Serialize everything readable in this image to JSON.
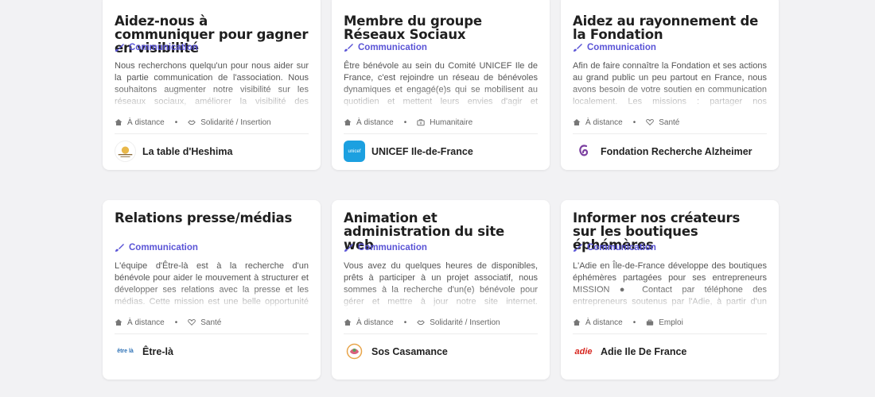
{
  "cards": [
    {
      "title": "Aidez-nous à communiquer pour gagner en visibilité",
      "tag": "Communication",
      "desc": "Nous recherchons quelqu'un pour nous aider sur la partie communication de l'association. Nous souhaitons augmenter notre visibilité sur les réseaux sociaux, améliorer la visibilité des évènements auxquels nous participons,",
      "location": "À distance",
      "cause": "Solidarité / Insertion",
      "cause_icon": "handshake-icon",
      "org": "La table d'Heshima"
    },
    {
      "title": "Membre du groupe Réseaux Sociaux",
      "tag": "Communication",
      "desc": "Être bénévole au sein du Comité UNICEF Ile de France, c'est rejoindre un réseau de bénévoles dynamiques et engagé(e)s qui se mobilisent au quotidien et mettent leurs envies d'agir et compétences au service des droits de l'enfant.",
      "location": "À distance",
      "cause": "Humanitaire",
      "cause_icon": "medkit-icon",
      "org": "UNICEF Ile-de-France"
    },
    {
      "title": "Aidez au rayonnement de la Fondation",
      "tag": "Communication",
      "desc": "Afin de faire connaître la Fondation et ses actions au grand public un peu partout en France, nous avons besoin de votre soutien en communication localement. Les missions : partager nos publications Instagram, Facebook et Linkedin",
      "location": "À distance",
      "cause": "Santé",
      "cause_icon": "heart-pulse-icon",
      "org": "Fondation Recherche Alzheimer"
    },
    {
      "title": "Relations presse/médias",
      "tag": "Communication",
      "desc": "L'équipe d'Être-là est à la recherche d'un bénévole pour aider le mouvement à structurer et développer ses relations avec la presse et les médias. Cette mission est une belle opportunité de mieux faire connaître l'accompagnement",
      "location": "À distance",
      "cause": "Santé",
      "cause_icon": "heart-pulse-icon",
      "org": "Être-là"
    },
    {
      "title": "Animation et administration du site web",
      "tag": "Communication",
      "desc": "Vous avez du quelques heures de disponibles, prêts à participer à un projet associatif, nous sommes à la recherche d'un(e) bénévole pour gérer et mettre à jour notre site internet. Également disponible à animer nos réseaux",
      "location": "À distance",
      "cause": "Solidarité / Insertion",
      "cause_icon": "handshake-icon",
      "org": "Sos Casamance"
    },
    {
      "title": "Informer nos créateurs sur les boutiques éphémères",
      "tag": "Communication",
      "desc": "L'Adie en Île-de-France développe des boutiques éphémères partagées pour ses entrepreneurs MISSION ● Contact par téléphone des entrepreneurs soutenus par l'Adie, à partir d'un listing des entrepreneurs de la région Ile-de-",
      "location": "À distance",
      "cause": "Emploi",
      "cause_icon": "briefcase-icon",
      "org": "Adie Ile De France"
    }
  ],
  "logos": {
    "unicef_text": "unicef",
    "etre_text": "être là",
    "adie_text": "adie"
  },
  "colors": {
    "accent": "#5a54d6",
    "background": "#f2f2f4",
    "card": "#ffffff"
  }
}
